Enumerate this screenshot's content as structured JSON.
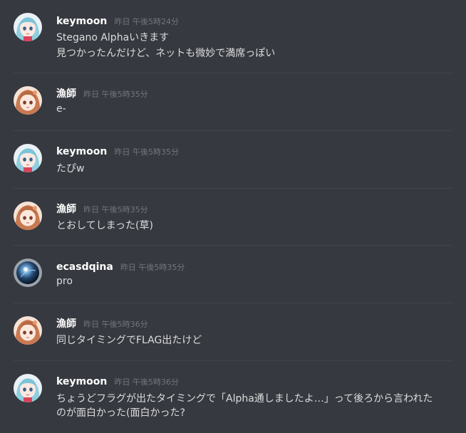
{
  "messages": [
    {
      "author": "keymoon",
      "timestamp": "昨日 午後5時24分",
      "avatar": "keymoon-avatar",
      "lines": [
        "Stegano Alphaいきます",
        "見つかったんだけど、ネットも微妙で満席っぽい"
      ]
    },
    {
      "author": "漁師",
      "timestamp": "昨日 午後5時35分",
      "avatar": "ryoushi-avatar",
      "lines": [
        "e-"
      ]
    },
    {
      "author": "keymoon",
      "timestamp": "昨日 午後5時35分",
      "avatar": "keymoon-avatar",
      "lines": [
        "たぴw"
      ]
    },
    {
      "author": "漁師",
      "timestamp": "昨日 午後5時35分",
      "avatar": "ryoushi-avatar",
      "lines": [
        "とおしてしまった(草)"
      ]
    },
    {
      "author": "ecasdqina",
      "timestamp": "昨日 午後5時35分",
      "avatar": "ecasdqina-avatar",
      "lines": [
        "pro"
      ]
    },
    {
      "author": "漁師",
      "timestamp": "昨日 午後5時36分",
      "avatar": "ryoushi-avatar",
      "lines": [
        "同じタイミングでFLAG出たけど"
      ]
    },
    {
      "author": "keymoon",
      "timestamp": "昨日 午後5時36分",
      "avatar": "keymoon-avatar",
      "lines": [
        "ちょうどフラグが出たタイミングで「Alpha通しましたよ…」って後ろから言われた",
        "のが面白かった(面白かった?"
      ]
    }
  ],
  "colors": {
    "background": "#36393f",
    "username": "#ffffff",
    "timestamp": "#72767d",
    "message_text": "#dcddde",
    "divider": "#40434a"
  }
}
